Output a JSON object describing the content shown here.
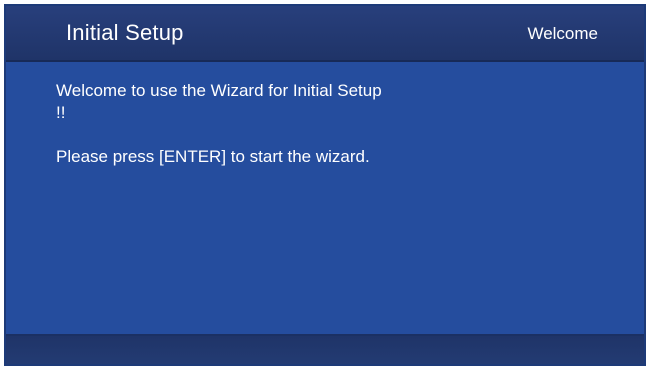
{
  "header": {
    "title": "Initial Setup",
    "step": "Welcome"
  },
  "content": {
    "line1": "Welcome to use the Wizard for Initial Setup !!",
    "line2": "Please press [ENTER] to start the wizard."
  },
  "colors": {
    "panel": "#254d9e",
    "header": "#1f3468",
    "text": "#ffffff"
  }
}
